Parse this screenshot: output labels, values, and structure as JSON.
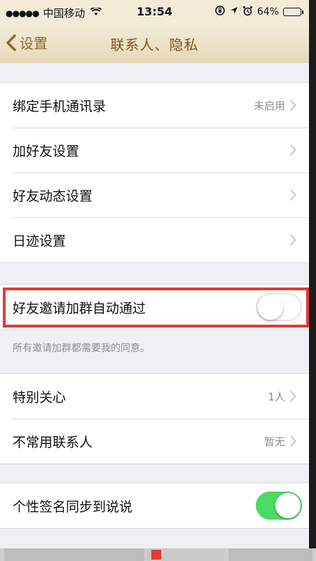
{
  "status_bar": {
    "signal": "●●●●●",
    "carrier": "中国移动",
    "wifi_icon": "wifi-icon",
    "time": "13:54",
    "icons": [
      "rotation-lock-icon",
      "location-icon",
      "alarm-icon"
    ],
    "battery_text": "64%",
    "battery_level": 0.64
  },
  "nav": {
    "back_label": "设置",
    "title": "联系人、隐私"
  },
  "section1": {
    "rows": [
      {
        "label": "绑定手机通讯录",
        "value": "未启用"
      },
      {
        "label": "加好友设置",
        "value": ""
      },
      {
        "label": "好友动态设置",
        "value": ""
      },
      {
        "label": "日迹设置",
        "value": ""
      }
    ]
  },
  "section2": {
    "label": "好友邀请加群自动通过",
    "toggle_on": false,
    "footnote": "所有邀请加群都需要我的同意。"
  },
  "section3": {
    "rows": [
      {
        "label": "特别关心",
        "value": "1人"
      },
      {
        "label": "不常用联系人",
        "value": "暂无"
      }
    ]
  },
  "section4": {
    "label": "个性签名同步到说说",
    "toggle_on": true
  },
  "colors": {
    "highlight": "#e53935",
    "toggle_on": "#4cd964",
    "nav_text": "#8a6a33"
  }
}
